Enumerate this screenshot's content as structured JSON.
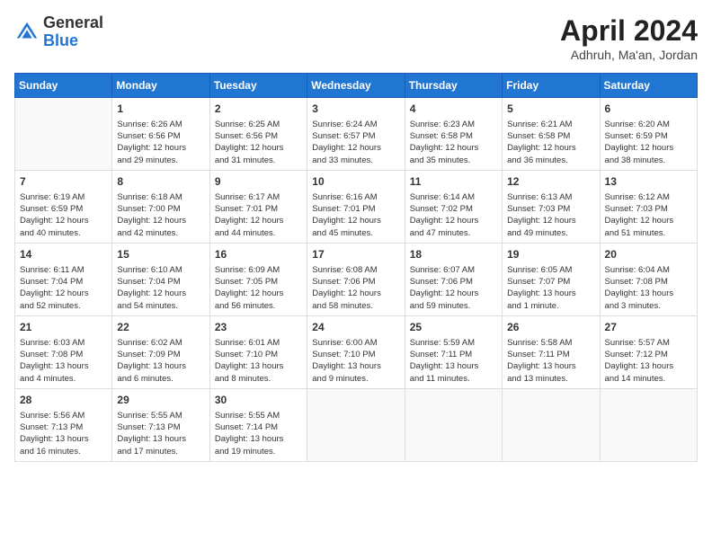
{
  "header": {
    "logo_general": "General",
    "logo_blue": "Blue",
    "month_title": "April 2024",
    "location": "Adhruh, Ma'an, Jordan"
  },
  "days_of_week": [
    "Sunday",
    "Monday",
    "Tuesday",
    "Wednesday",
    "Thursday",
    "Friday",
    "Saturday"
  ],
  "weeks": [
    [
      {
        "day": "",
        "info": ""
      },
      {
        "day": "1",
        "info": "Sunrise: 6:26 AM\nSunset: 6:56 PM\nDaylight: 12 hours\nand 29 minutes."
      },
      {
        "day": "2",
        "info": "Sunrise: 6:25 AM\nSunset: 6:56 PM\nDaylight: 12 hours\nand 31 minutes."
      },
      {
        "day": "3",
        "info": "Sunrise: 6:24 AM\nSunset: 6:57 PM\nDaylight: 12 hours\nand 33 minutes."
      },
      {
        "day": "4",
        "info": "Sunrise: 6:23 AM\nSunset: 6:58 PM\nDaylight: 12 hours\nand 35 minutes."
      },
      {
        "day": "5",
        "info": "Sunrise: 6:21 AM\nSunset: 6:58 PM\nDaylight: 12 hours\nand 36 minutes."
      },
      {
        "day": "6",
        "info": "Sunrise: 6:20 AM\nSunset: 6:59 PM\nDaylight: 12 hours\nand 38 minutes."
      }
    ],
    [
      {
        "day": "7",
        "info": "Sunrise: 6:19 AM\nSunset: 6:59 PM\nDaylight: 12 hours\nand 40 minutes."
      },
      {
        "day": "8",
        "info": "Sunrise: 6:18 AM\nSunset: 7:00 PM\nDaylight: 12 hours\nand 42 minutes."
      },
      {
        "day": "9",
        "info": "Sunrise: 6:17 AM\nSunset: 7:01 PM\nDaylight: 12 hours\nand 44 minutes."
      },
      {
        "day": "10",
        "info": "Sunrise: 6:16 AM\nSunset: 7:01 PM\nDaylight: 12 hours\nand 45 minutes."
      },
      {
        "day": "11",
        "info": "Sunrise: 6:14 AM\nSunset: 7:02 PM\nDaylight: 12 hours\nand 47 minutes."
      },
      {
        "day": "12",
        "info": "Sunrise: 6:13 AM\nSunset: 7:03 PM\nDaylight: 12 hours\nand 49 minutes."
      },
      {
        "day": "13",
        "info": "Sunrise: 6:12 AM\nSunset: 7:03 PM\nDaylight: 12 hours\nand 51 minutes."
      }
    ],
    [
      {
        "day": "14",
        "info": "Sunrise: 6:11 AM\nSunset: 7:04 PM\nDaylight: 12 hours\nand 52 minutes."
      },
      {
        "day": "15",
        "info": "Sunrise: 6:10 AM\nSunset: 7:04 PM\nDaylight: 12 hours\nand 54 minutes."
      },
      {
        "day": "16",
        "info": "Sunrise: 6:09 AM\nSunset: 7:05 PM\nDaylight: 12 hours\nand 56 minutes."
      },
      {
        "day": "17",
        "info": "Sunrise: 6:08 AM\nSunset: 7:06 PM\nDaylight: 12 hours\nand 58 minutes."
      },
      {
        "day": "18",
        "info": "Sunrise: 6:07 AM\nSunset: 7:06 PM\nDaylight: 12 hours\nand 59 minutes."
      },
      {
        "day": "19",
        "info": "Sunrise: 6:05 AM\nSunset: 7:07 PM\nDaylight: 13 hours\nand 1 minute."
      },
      {
        "day": "20",
        "info": "Sunrise: 6:04 AM\nSunset: 7:08 PM\nDaylight: 13 hours\nand 3 minutes."
      }
    ],
    [
      {
        "day": "21",
        "info": "Sunrise: 6:03 AM\nSunset: 7:08 PM\nDaylight: 13 hours\nand 4 minutes."
      },
      {
        "day": "22",
        "info": "Sunrise: 6:02 AM\nSunset: 7:09 PM\nDaylight: 13 hours\nand 6 minutes."
      },
      {
        "day": "23",
        "info": "Sunrise: 6:01 AM\nSunset: 7:10 PM\nDaylight: 13 hours\nand 8 minutes."
      },
      {
        "day": "24",
        "info": "Sunrise: 6:00 AM\nSunset: 7:10 PM\nDaylight: 13 hours\nand 9 minutes."
      },
      {
        "day": "25",
        "info": "Sunrise: 5:59 AM\nSunset: 7:11 PM\nDaylight: 13 hours\nand 11 minutes."
      },
      {
        "day": "26",
        "info": "Sunrise: 5:58 AM\nSunset: 7:11 PM\nDaylight: 13 hours\nand 13 minutes."
      },
      {
        "day": "27",
        "info": "Sunrise: 5:57 AM\nSunset: 7:12 PM\nDaylight: 13 hours\nand 14 minutes."
      }
    ],
    [
      {
        "day": "28",
        "info": "Sunrise: 5:56 AM\nSunset: 7:13 PM\nDaylight: 13 hours\nand 16 minutes."
      },
      {
        "day": "29",
        "info": "Sunrise: 5:55 AM\nSunset: 7:13 PM\nDaylight: 13 hours\nand 17 minutes."
      },
      {
        "day": "30",
        "info": "Sunrise: 5:55 AM\nSunset: 7:14 PM\nDaylight: 13 hours\nand 19 minutes."
      },
      {
        "day": "",
        "info": ""
      },
      {
        "day": "",
        "info": ""
      },
      {
        "day": "",
        "info": ""
      },
      {
        "day": "",
        "info": ""
      }
    ]
  ]
}
